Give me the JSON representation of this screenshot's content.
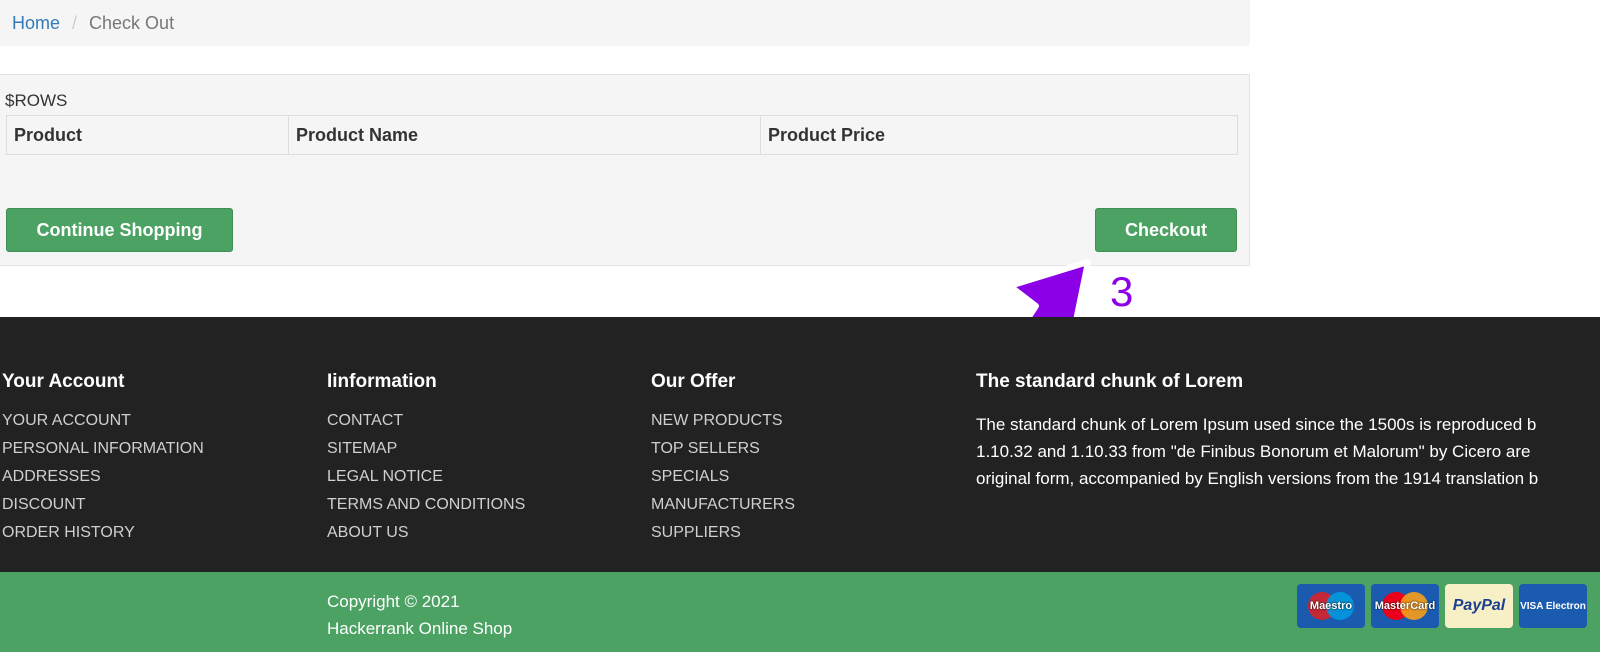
{
  "breadcrumb": {
    "home": "Home",
    "separator": "/",
    "current": "Check Out"
  },
  "cart": {
    "rows_placeholder": "$ROWS",
    "columns": [
      "Product",
      "Product Name",
      "Product Price"
    ],
    "continue_label": "Continue Shopping",
    "checkout_label": "Checkout"
  },
  "annotation": {
    "number": "3",
    "color": "#8b00e6"
  },
  "footer": {
    "your_account": {
      "heading": "Your Account",
      "items": [
        "YOUR ACCOUNT",
        "PERSONAL INFORMATION",
        "ADDRESSES",
        "DISCOUNT",
        "ORDER HISTORY"
      ]
    },
    "information": {
      "heading": "Iinformation",
      "items": [
        "CONTACT",
        "SITEMAP",
        "LEGAL NOTICE",
        "TERMS AND CONDITIONS",
        "ABOUT US"
      ]
    },
    "our_offer": {
      "heading": "Our Offer",
      "items": [
        "NEW PRODUCTS",
        "TOP SELLERS",
        "SPECIALS",
        "MANUFACTURERS",
        "SUPPLIERS"
      ]
    },
    "lorem": {
      "heading": "The standard chunk of Lorem",
      "lines": [
        "The standard chunk of Lorem Ipsum used since the 1500s is reproduced b",
        "1.10.32 and 1.10.33 from \"de Finibus Bonorum et Malorum\" by Cicero are",
        "original form, accompanied by English versions from the 1914 translation b"
      ]
    },
    "copyright_line1": "Copyright © 2021",
    "copyright_line2": "Hackerrank Online Shop",
    "payment_cards": [
      {
        "name": "Maestro",
        "icon": "maestro-icon"
      },
      {
        "name": "MasterCard",
        "icon": "mastercard-icon"
      },
      {
        "name": "PayPal",
        "icon": "paypal-icon"
      },
      {
        "name": "VISA Electron",
        "icon": "visa-electron-icon"
      }
    ]
  },
  "colors": {
    "accent_green": "#4ba262",
    "footer_dark": "#222222",
    "link_blue": "#337ab7"
  }
}
